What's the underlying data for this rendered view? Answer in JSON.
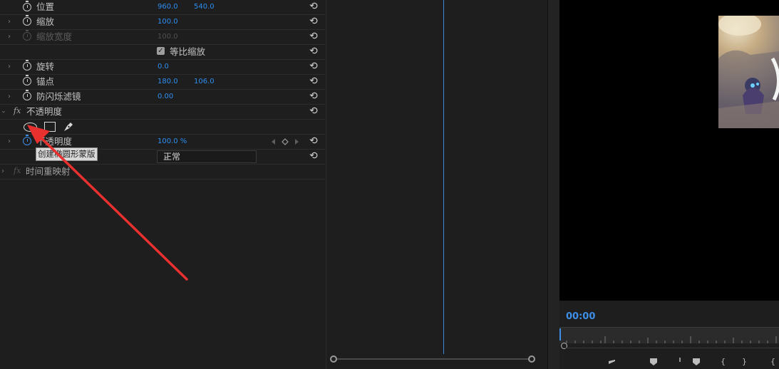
{
  "effect_controls": {
    "motion_rows": [
      {
        "label": "位置",
        "value1": "960.0",
        "value2": "540.0"
      },
      {
        "label": "缩放",
        "value1": "100.0"
      },
      {
        "label": "缩放宽度",
        "value1": "100.0"
      },
      {
        "label": "等比缩放"
      },
      {
        "label": "旋转",
        "value1": "0.0"
      },
      {
        "label": "锚点",
        "value1": "180.0",
        "value2": "106.0"
      },
      {
        "label": "防闪烁滤镜",
        "value1": "0.00"
      }
    ],
    "uniform_scale_checked": true,
    "opacity": {
      "fx_label": "fx",
      "section_label": "不透明度",
      "mask_tools": [
        "ellipse-mask",
        "rectangle-mask",
        "pen-mask"
      ],
      "property_label": "不透明度",
      "value": "100.0 %",
      "blend_mode": "正常"
    },
    "time_remap": {
      "fx_label": "fx",
      "label": "时间重映射"
    },
    "tooltip": "创建椭圆形蒙版",
    "reset_icon_glyph": "⟲",
    "twirl_glyph": "›",
    "check_glyph": "✓",
    "chevron_glyph": "⌄"
  },
  "program_monitor": {
    "timecode": "00:00",
    "accent_color": "#3d8ee6"
  }
}
